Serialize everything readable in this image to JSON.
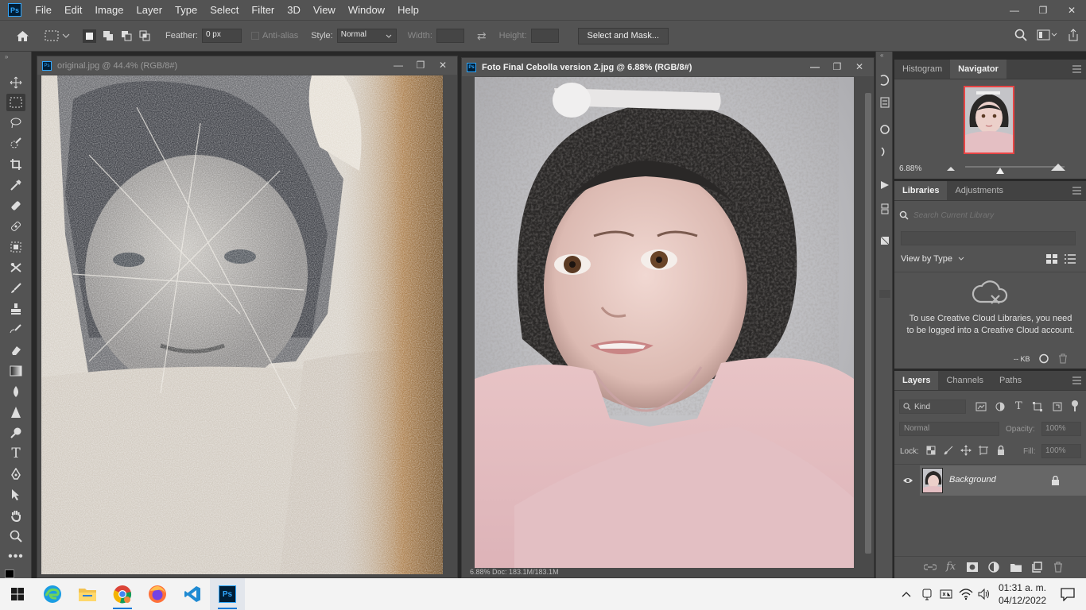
{
  "menubar": {
    "items": [
      "File",
      "Edit",
      "Image",
      "Layer",
      "Type",
      "Select",
      "Filter",
      "3D",
      "View",
      "Window",
      "Help"
    ]
  },
  "options": {
    "feather_label": "Feather:",
    "feather_value": "0 px",
    "antialias_label": "Anti-alias",
    "style_label": "Style:",
    "style_value": "Normal",
    "width_label": "Width:",
    "height_label": "Height:",
    "select_mask": "Select and Mask..."
  },
  "doc1": {
    "title": "original.jpg @ 44.4% (RGB/8#)"
  },
  "doc2": {
    "title": "Foto Final Cebolla version 2.jpg @ 6.88% (RGB/8#)",
    "status": "6.88%          Doc: 183.1M/183.1M"
  },
  "navigator": {
    "tabs": [
      "Histogram",
      "Navigator"
    ],
    "zoom": "6.88%",
    "zoom_fraction": 0.35
  },
  "libraries": {
    "tabs": [
      "Libraries",
      "Adjustments"
    ],
    "search_placeholder": "Search Current Library",
    "view_by": "View by Type",
    "message": "To use Creative Cloud Libraries, you need to be logged into a Creative Cloud account.",
    "size": "-- KB"
  },
  "layers": {
    "tabs": [
      "Layers",
      "Channels",
      "Paths"
    ],
    "kind": "Kind",
    "blend": "Normal",
    "opacity_label": "Opacity:",
    "opacity": "100%",
    "lock_label": "Lock:",
    "fill_label": "Fill:",
    "fill": "100%",
    "layer_name": "Background"
  },
  "taskbar": {
    "time": "01:31 a. m.",
    "date": "04/12/2022"
  },
  "colors": {
    "accent": "#31a8ff",
    "panel": "#535353",
    "dark": "#282828"
  }
}
